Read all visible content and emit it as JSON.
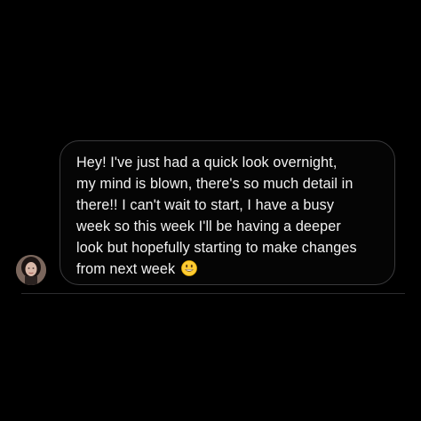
{
  "conversation": {
    "messages": [
      {
        "sender_avatar": "avatar-photo",
        "lines": [
          "Hey! I've just had a quick look overnight,",
          "my mind is blown, there's so much detail in",
          "there!! I can't wait to start, I have a busy",
          "week so this week I'll be having a deeper",
          "look but hopefully starting to make changes",
          "from next week"
        ],
        "emoji": "grinning-face-emoji"
      }
    ]
  },
  "colors": {
    "background": "#000000",
    "bubble_border": "#3a3a3c",
    "text": "#f2f2f2",
    "emoji_yellow": "#ffcc33"
  }
}
